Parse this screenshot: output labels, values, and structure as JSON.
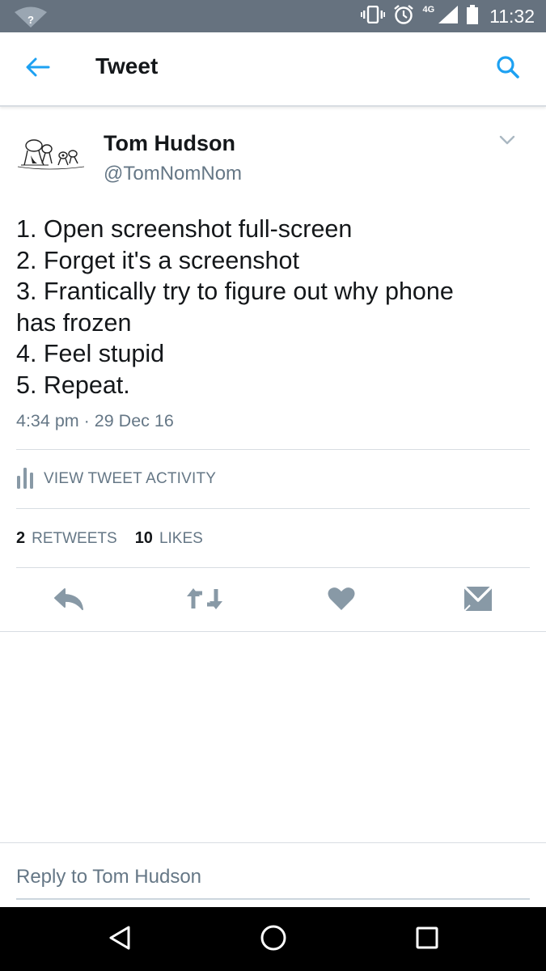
{
  "status_bar": {
    "time": "11:32",
    "network": "4G",
    "wifi_badge": "?",
    "icons": [
      "wifi-icon",
      "vibrate-icon",
      "alarm-icon",
      "signal-icon",
      "battery-icon"
    ]
  },
  "app_bar": {
    "title": "Tweet",
    "icons": [
      "back-arrow-icon",
      "search-icon"
    ]
  },
  "tweet": {
    "author_name": "Tom Hudson",
    "author_handle": "@TomNomNom",
    "lines": [
      "1. Open screenshot full-screen",
      "2. Forget it's a screenshot",
      "3. Frantically try to figure out why phone",
      "has frozen",
      "4. Feel stupid",
      "5. Repeat."
    ],
    "timestamp": "4:34 pm · 29 Dec 16"
  },
  "activity": {
    "label": "VIEW TWEET ACTIVITY",
    "icon": "bar-chart-icon"
  },
  "stats": {
    "retweets_count": "2",
    "retweets_label": "RETWEETS",
    "likes_count": "10",
    "likes_label": "LIKES"
  },
  "actions": {
    "icons": [
      "reply-icon",
      "retweet-icon",
      "heart-icon",
      "message-icon"
    ]
  },
  "reply": {
    "placeholder": "Reply to Tom Hudson"
  },
  "nav_bar": {
    "icons": [
      "back-triangle-icon",
      "home-circle-icon",
      "recents-square-icon"
    ]
  },
  "colors": {
    "status_bar": "#66727f",
    "accent_blue": "#1da1f2",
    "secondary_text": "#657786",
    "action_icon": "#8899a6",
    "divider": "#d8dde2"
  }
}
